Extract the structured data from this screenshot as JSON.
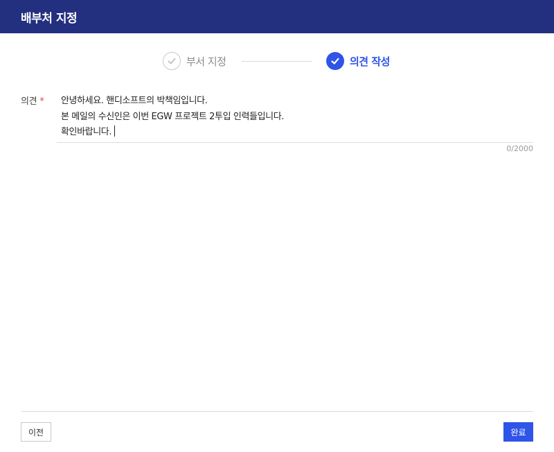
{
  "header": {
    "title": "배부처 지정"
  },
  "steps": [
    {
      "label": "부서 지정",
      "state": "done",
      "icon": "check-icon"
    },
    {
      "label": "의견 작성",
      "state": "active",
      "icon": "check-icon"
    }
  ],
  "form": {
    "label": "의견",
    "required_mark": "*",
    "opinion_lines": [
      "안녕하세요. 핸디소프트의 박책임입니다.",
      "본 메일의 수신인은 이번 EGW 프로젝트 2투입 인력들입니다.",
      "확인바랍니다."
    ],
    "counter": "0/2000"
  },
  "footer": {
    "prev_label": "이전",
    "done_label": "완료"
  },
  "colors": {
    "header_bg": "#23307f",
    "accent": "#2f54e8",
    "required": "#e64545"
  }
}
